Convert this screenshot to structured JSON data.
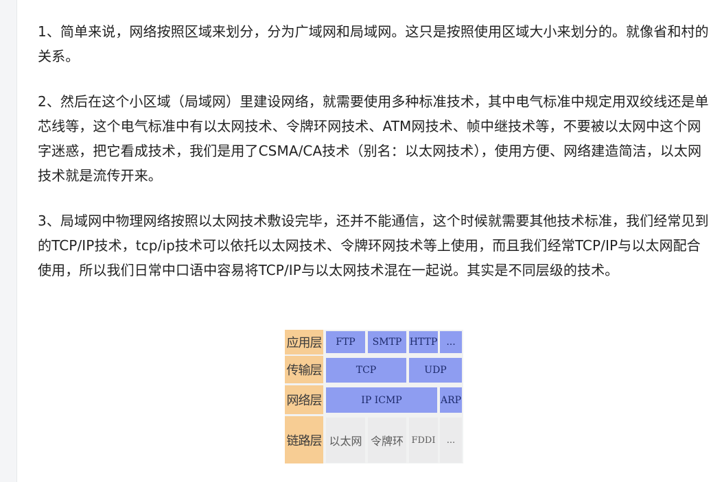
{
  "article": {
    "paragraphs": [
      "1、简单来说，网络按照区域来划分，分为广域网和局域网。这只是按照使用区域大小来划分的。就像省和村的关系。",
      "2、然后在这个小区域（局域网）里建设网络，就需要使用多种标准技术，其中电气标准中规定用双绞线还是单芯线等，这个电气标准中有以太网技术、令牌环网技术、ATM网技术、帧中继技术等，不要被以太网中这个网字迷惑，把它看成技术，我们是用了CSMA/CA技术（别名：以太网技术），使用方便、网络建造简洁，以太网技术就是流传开来。",
      "3、局域网中物理网络按照以太网技术敷设完毕，还并不能通信，这个时候就需要其他技术标准，我们经常见到的TCP/IP技术，tcp/ip技术可以依托以太网技术、令牌环网技术等上使用，而且我们经常TCP/IP与以太网配合使用，所以我们日常中口语中容易将TCP/IP与以太网技术混在一起说。其实是不同层级的技术。"
    ]
  },
  "diagram": {
    "layers": {
      "application": "应用层",
      "transport": "传输层",
      "network": "网络层",
      "link": "链路层"
    },
    "application_protocols": [
      "FTP",
      "SMTP",
      "HTTP",
      "..."
    ],
    "transport_protocols": [
      "TCP",
      "UDP"
    ],
    "network_protocols": [
      "IP ICMP",
      "ARP"
    ],
    "link_protocols": [
      "以太网",
      "令牌环",
      "FDDI",
      "..."
    ],
    "colors": {
      "layer_label": "#f7cd94",
      "protocol": "#8e9df1",
      "link_cell": "#ebebec"
    }
  }
}
